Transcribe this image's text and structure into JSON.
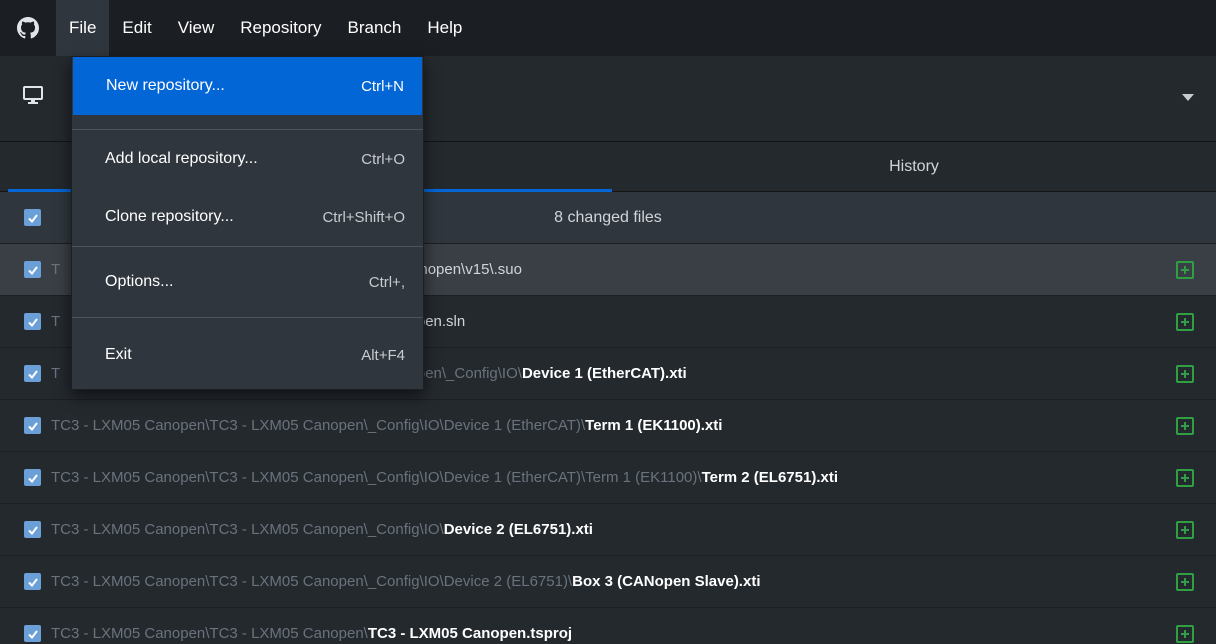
{
  "menubar": {
    "app_icon": "github-icon",
    "items": [
      {
        "label": "File",
        "active": true
      },
      {
        "label": "Edit"
      },
      {
        "label": "View"
      },
      {
        "label": "Repository"
      },
      {
        "label": "Branch"
      },
      {
        "label": "Help"
      }
    ]
  },
  "toolbar": {
    "repo_icon": "desktop-icon",
    "dropdown_icon": "caret-down-icon"
  },
  "tabs": {
    "changes": "",
    "history": "History"
  },
  "changes_header": {
    "count_text": "8 changed files"
  },
  "file_menu": {
    "items": [
      {
        "label": "New repository...",
        "shortcut": "Ctrl+N",
        "highlighted": true
      },
      {
        "label": "Add local repository...",
        "shortcut": "Ctrl+O"
      },
      {
        "label": "Clone repository...",
        "shortcut": "Ctrl+Shift+O"
      },
      {
        "label": "Options...",
        "shortcut": "Ctrl+,"
      },
      {
        "label": "Exit",
        "shortcut": "Alt+F4"
      }
    ]
  },
  "files": [
    {
      "dir": "TC3 - LXM05 Canopen\\TC3 - LXM05 Canopen\\",
      "name": "Canopen\\v15\\.suo",
      "visible_dir": "T",
      "visible_name": "Canopen\\v15\\.suo",
      "selected": true
    },
    {
      "dir": "T",
      "name": "nopen.sln",
      "visible_dir": "T",
      "visible_name": "nopen.sln"
    },
    {
      "dir": "T",
      "name": "Device 1 (EtherCAT).xti",
      "visible_dir": "nopen\\_Config\\IO\\",
      "visible_name": "Device 1 (EtherCAT).xti"
    },
    {
      "dir": "TC3 - LXM05 Canopen\\TC3 - LXM05 Canopen\\_Config\\IO\\Device 1 (EtherCAT)\\",
      "name": "Term 1 (EK1100).xti"
    },
    {
      "dir": "TC3 - LXM05 Canopen\\TC3 - LXM05 Canopen\\_Config\\IO\\Device 1 (EtherCAT)\\Term 1 (EK1100)\\",
      "name": "Term 2 (EL6751).xti"
    },
    {
      "dir": "TC3 - LXM05 Canopen\\TC3 - LXM05 Canopen\\_Config\\IO\\",
      "name": "Device 2 (EL6751).xti"
    },
    {
      "dir": "TC3 - LXM05 Canopen\\TC3 - LXM05 Canopen\\_Config\\IO\\Device 2 (EL6751)\\",
      "name": "Box 3 (CANopen Slave).xti"
    },
    {
      "dir": "TC3 - LXM05 Canopen\\TC3 - LXM05 Canopen\\",
      "name": "TC3 - LXM05 Canopen.tsproj"
    }
  ]
}
